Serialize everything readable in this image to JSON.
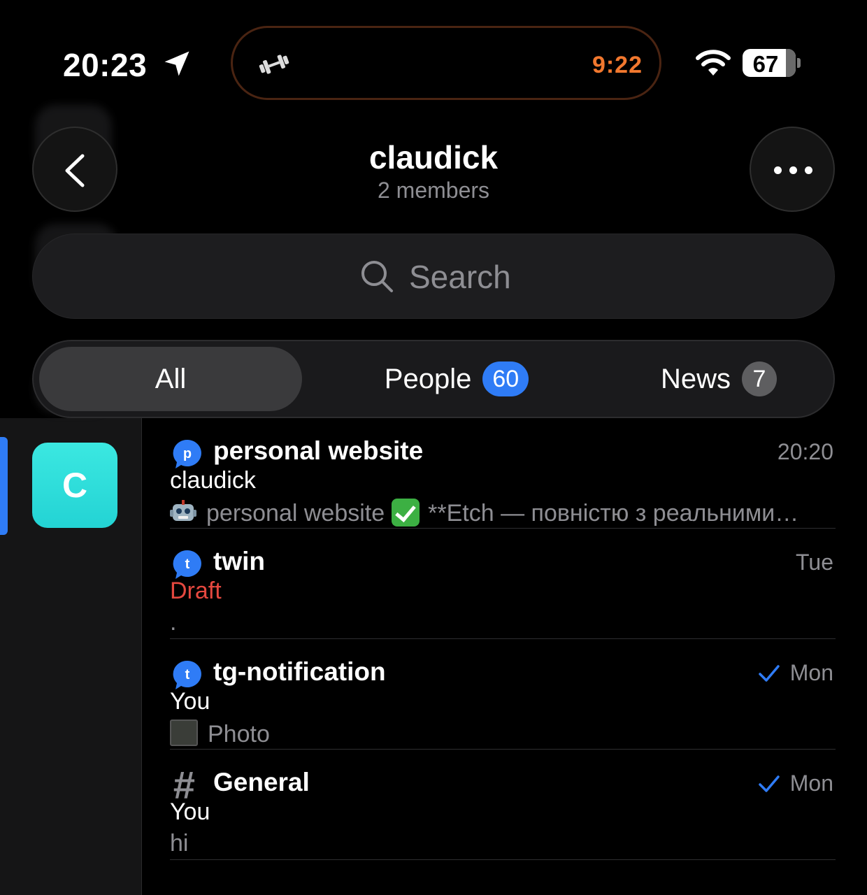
{
  "status_bar": {
    "time": "20:23",
    "live_activity_timer": "9:22",
    "battery_percent": "67",
    "accent_timer_color": "#f2782e"
  },
  "header": {
    "title": "claudick",
    "subtitle": "2 members"
  },
  "search": {
    "placeholder": "Search"
  },
  "tabs": [
    {
      "label": "All",
      "selected": true
    },
    {
      "label": "People",
      "badge": "60",
      "badge_color": "#2f7cf6"
    },
    {
      "label": "News",
      "badge": "7"
    }
  ],
  "sidebar": {
    "folders": [
      {
        "letter": "C",
        "selected": true,
        "color": "#2ad9d9"
      }
    ]
  },
  "chats": [
    {
      "icon": "topic-bubble-icon",
      "icon_letter": "p",
      "name": "personal website",
      "date": "20:20",
      "sender": "claudick",
      "preview_part1": "personal website",
      "preview_part2": "**Etch — повністю з реальними…"
    },
    {
      "icon": "topic-bubble-icon",
      "icon_letter": "t",
      "name": "twin",
      "date": "Tue",
      "sender": "Draft",
      "preview": "."
    },
    {
      "icon": "topic-bubble-icon",
      "icon_letter": "t",
      "name": "tg-notification",
      "date": "Mon",
      "read": true,
      "sender": "You",
      "preview": "Photo"
    },
    {
      "icon": "hash-icon",
      "icon_letter": "#",
      "name": "General",
      "date": "Mon",
      "read": true,
      "sender": "You",
      "preview": "hi"
    }
  ]
}
